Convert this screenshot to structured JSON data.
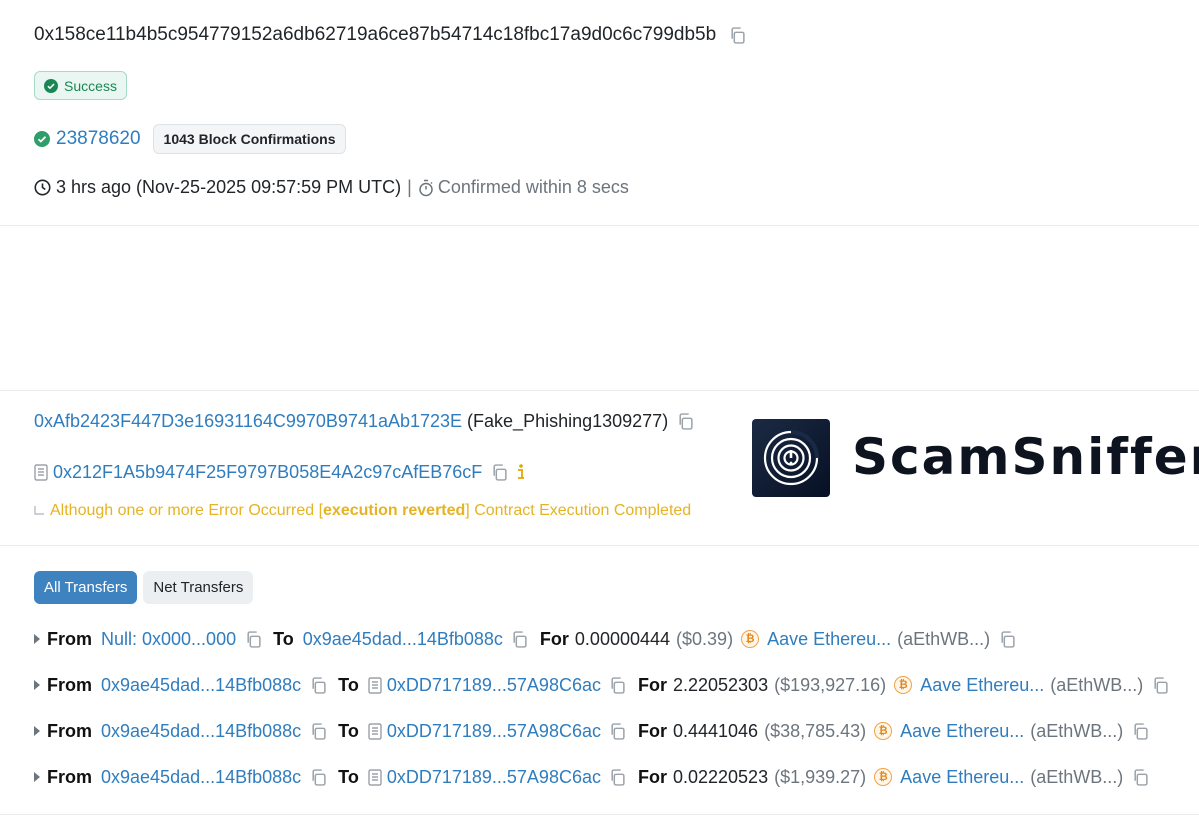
{
  "tx": {
    "hash": "0x158ce11b4b5c954779152a6db62719a6ce87b54714c18fbc17a9d0c6c799db5b",
    "status": "Success",
    "block": "23878620",
    "confirmations": "1043 Block Confirmations",
    "timestamp": "3 hrs ago (Nov-25-2025 09:57:59 PM UTC)",
    "separator": "|",
    "confirmed_within": "Confirmed within 8 secs"
  },
  "interaction": {
    "from_address": "0xAfb2423F447D3e16931164C9970B9741aAb1723E",
    "from_label": "(Fake_Phishing1309277)",
    "contract_address": "0x212F1A5b9474F25F9797B058E4A2c97cAfEB76cF",
    "error_prefix": "Although one or more Error Occurred [",
    "error_bold": "execution reverted",
    "error_suffix": "] Contract Execution Completed"
  },
  "logo": {
    "text": "ScamSniffer"
  },
  "tabs": [
    "All Transfers",
    "Net Transfers"
  ],
  "labels": {
    "from": "From",
    "to": "To",
    "for": "For"
  },
  "transfers": [
    {
      "from": "Null: 0x000...000",
      "to": "0x9ae45dad...14Bfb088c",
      "to_contract": false,
      "amount": "0.00000444",
      "usd": "($0.39)",
      "token": "Aave Ethereu...",
      "symbol": "(aEthWB...)"
    },
    {
      "from": "0x9ae45dad...14Bfb088c",
      "to": "0xDD717189...57A98C6ac",
      "to_contract": true,
      "amount": "2.22052303",
      "usd": "($193,927.16)",
      "token": "Aave Ethereu...",
      "symbol": "(aEthWB...)"
    },
    {
      "from": "0x9ae45dad...14Bfb088c",
      "to": "0xDD717189...57A98C6ac",
      "to_contract": true,
      "amount": "0.4441046",
      "usd": "($38,785.43)",
      "token": "Aave Ethereu...",
      "symbol": "(aEthWB...)"
    },
    {
      "from": "0x9ae45dad...14Bfb088c",
      "to": "0xDD717189...57A98C6ac",
      "to_contract": true,
      "amount": "0.02220523",
      "usd": "($1,939.27)",
      "token": "Aave Ethereu...",
      "symbol": "(aEthWB...)"
    }
  ]
}
